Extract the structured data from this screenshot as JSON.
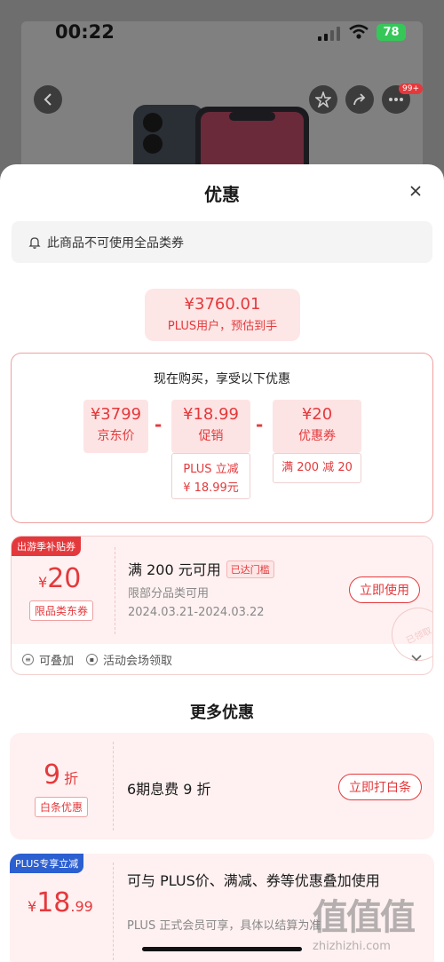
{
  "status_bar": {
    "time": "00:22",
    "battery": "78"
  },
  "header": {
    "badge": "99+"
  },
  "sheet": {
    "title": "优惠",
    "notice": "此商品不可使用全品类券",
    "estimate": {
      "price": "¥3760.01",
      "label": "PLUS用户，预估到手"
    },
    "calc": {
      "title": "现在购买，享受以下优惠",
      "minus": "-",
      "items": [
        {
          "value": "¥3799",
          "label": "京东价"
        },
        {
          "value": "¥18.99",
          "label": "促销"
        },
        {
          "value": "¥20",
          "label": "优惠券"
        }
      ],
      "promo_detail_1": "PLUS 立减",
      "promo_detail_2": "¥ 18.99元",
      "coupon_detail": "满 200 减 20"
    },
    "coupon": {
      "tag": "出游季补贴券",
      "symbol": "¥",
      "amount": "20",
      "type": "限品类东券",
      "condition": "满 200 元可用",
      "met": "已达门槛",
      "scope": "限部分品类可用",
      "dates": "2024.03.21-2024.03.22",
      "button": "立即使用",
      "stamp": "已领取",
      "stackable": "可叠加",
      "source": "活动会场领取"
    },
    "more_title": "更多优惠",
    "baitiao": {
      "value": "9",
      "unit": "折",
      "chip": "白条优惠",
      "text": "6期息费 9 折",
      "button": "立即打白条"
    },
    "plus": {
      "tag": "PLUS专享立减",
      "symbol": "¥",
      "int": "18",
      "dec": ".99",
      "text": "可与 PLUS价、满减、券等优惠叠加使用",
      "note": "PLUS 正式会员可享，具体以结算为准"
    }
  },
  "watermark": {
    "brand": "值值值",
    "url": "zhizhizhi.com"
  }
}
